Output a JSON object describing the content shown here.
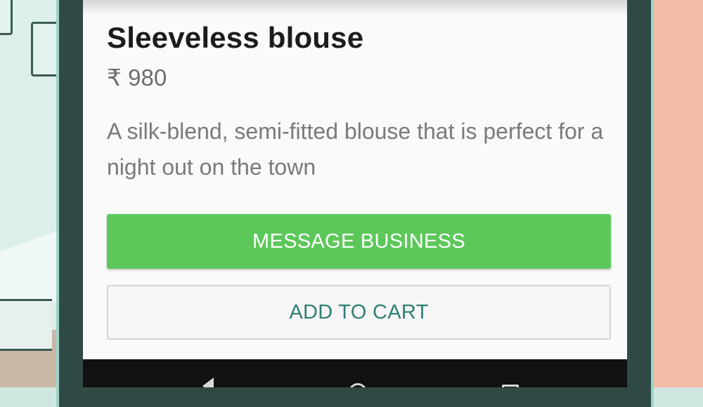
{
  "product": {
    "title": "Sleeveless blouse",
    "price": "₹ 980",
    "description": "A silk-blend, semi-fitted blouse that is perfect for a night out on the town"
  },
  "actions": {
    "message_business_label": "MESSAGE BUSINESS",
    "add_to_cart_label": "ADD TO CART"
  },
  "navbar": {
    "icons": [
      "back-icon",
      "home-icon",
      "recents-icon"
    ]
  },
  "colors": {
    "message_button": "#5cc85a",
    "add_to_cart_text": "#2f7f73",
    "title_text": "#1c1c1c",
    "secondary_text": "#7a7a7a",
    "navbar": "#111111"
  }
}
